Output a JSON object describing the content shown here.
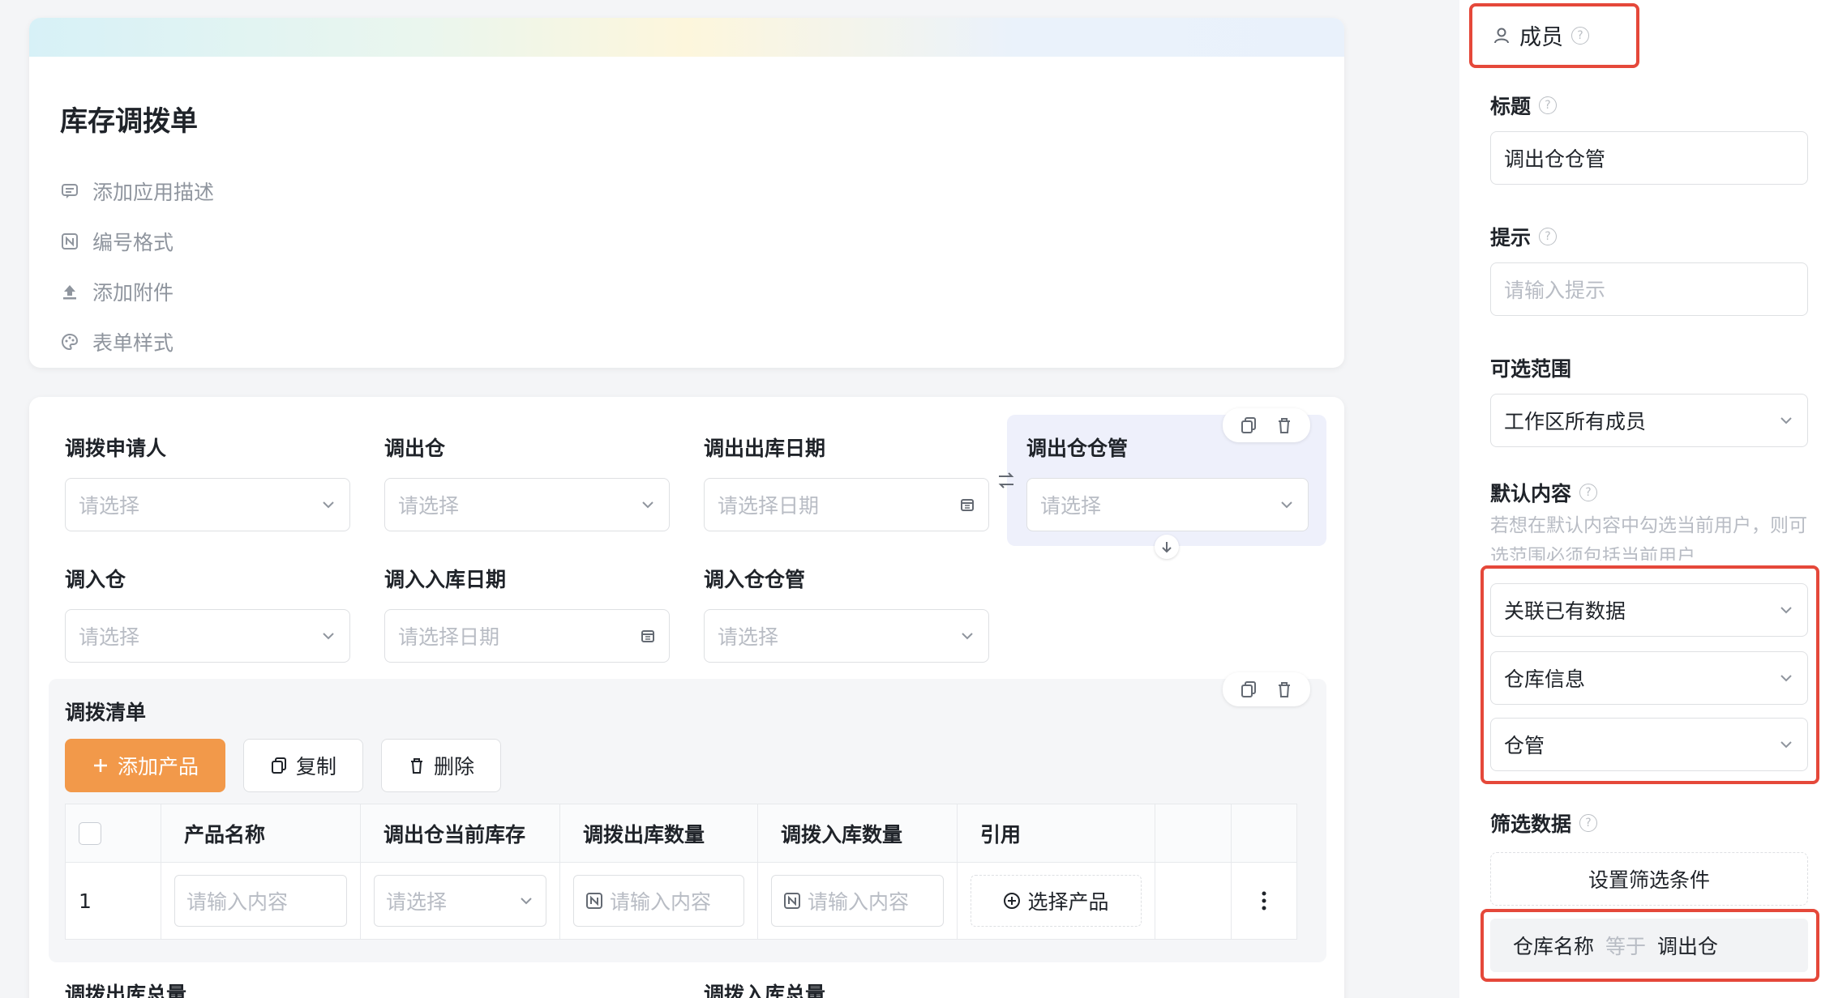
{
  "form": {
    "title": "库存调拨单",
    "links": [
      "添加应用描述",
      "编号格式",
      "添加附件",
      "表单样式"
    ]
  },
  "fields": {
    "applicant": {
      "label": "调拨申请人",
      "placeholder": "请选择"
    },
    "out_warehouse": {
      "label": "调出仓",
      "placeholder": "请选择"
    },
    "out_date": {
      "label": "调出出库日期",
      "placeholder": "请选择日期"
    },
    "out_keeper": {
      "label": "调出仓仓管",
      "placeholder": "请选择"
    },
    "in_warehouse": {
      "label": "调入仓",
      "placeholder": "请选择"
    },
    "in_date": {
      "label": "调入入库日期",
      "placeholder": "请选择日期"
    },
    "in_keeper": {
      "label": "调入仓仓管",
      "placeholder": "请选择"
    }
  },
  "list": {
    "title": "调拨清单",
    "add_label": "添加产品",
    "copy_label": "复制",
    "delete_label": "删除",
    "columns": [
      "产品名称",
      "调出仓当前库存",
      "调拨出库数量",
      "调拨入库数量",
      "引用"
    ],
    "row": {
      "index": "1",
      "name_placeholder": "请输入内容",
      "stock_placeholder": "请选择",
      "out_qty_placeholder": "请输入内容",
      "in_qty_placeholder": "请输入内容",
      "ref_button": "选择产品"
    }
  },
  "totals": {
    "out_total": "调拨出库总量",
    "in_total": "调拨入库总量"
  },
  "panel": {
    "type_label": "成员",
    "title_label": "标题",
    "title_value": "调出仓仓管",
    "hint_label": "提示",
    "hint_placeholder": "请输入提示",
    "scope_label": "可选范围",
    "scope_value": "工作区所有成员",
    "default_label": "默认内容",
    "default_note": "若想在默认内容中勾选当前用户，则可选范围必须包括当前用户",
    "default_source": "关联已有数据",
    "default_table": "仓库信息",
    "default_field": "仓管",
    "filter_label": "筛选数据",
    "filter_button": "设置筛选条件",
    "condition": {
      "field": "仓库名称",
      "op": "等于",
      "value": "调出仓"
    }
  },
  "colors": {
    "accent": "#f2994a",
    "highlight": "#e5483a",
    "focus_bg": "#eef0fb"
  }
}
